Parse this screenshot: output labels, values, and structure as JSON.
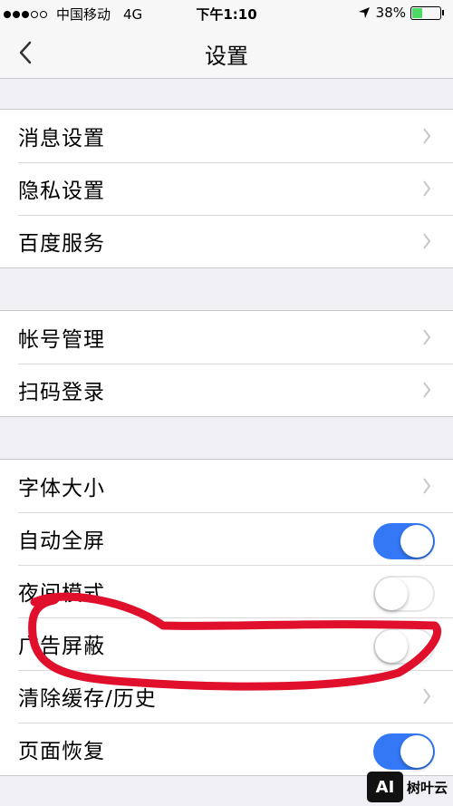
{
  "status_bar": {
    "carrier": "中国移动",
    "network": "4G",
    "time": "下午1:10",
    "battery": "38%",
    "battery_level": 0.38,
    "signal_bars_filled": 3,
    "signal_bars_total": 5
  },
  "nav": {
    "title": "设置",
    "back_icon": "chevron-left-icon"
  },
  "groups": [
    {
      "items": [
        {
          "label": "消息设置",
          "control": "chevron"
        },
        {
          "label": "隐私设置",
          "control": "chevron"
        },
        {
          "label": "百度服务",
          "control": "chevron"
        }
      ]
    },
    {
      "items": [
        {
          "label": "帐号管理",
          "control": "chevron"
        },
        {
          "label": "扫码登录",
          "control": "chevron"
        }
      ]
    },
    {
      "items": [
        {
          "label": "字体大小",
          "control": "chevron"
        },
        {
          "label": "自动全屏",
          "control": "toggle",
          "on": true
        },
        {
          "label": "夜间模式",
          "control": "toggle",
          "on": false
        },
        {
          "label": "广告屏蔽",
          "control": "toggle",
          "on": false
        },
        {
          "label": "清除缓存/历史",
          "control": "chevron"
        },
        {
          "label": "页面恢复",
          "control": "toggle",
          "on": true
        }
      ]
    }
  ],
  "watermark": {
    "logo": "AI",
    "text": "树叶云"
  },
  "colors": {
    "accent": "#3478f6",
    "annotation": "#e0102c",
    "battery": "#4cd964"
  }
}
